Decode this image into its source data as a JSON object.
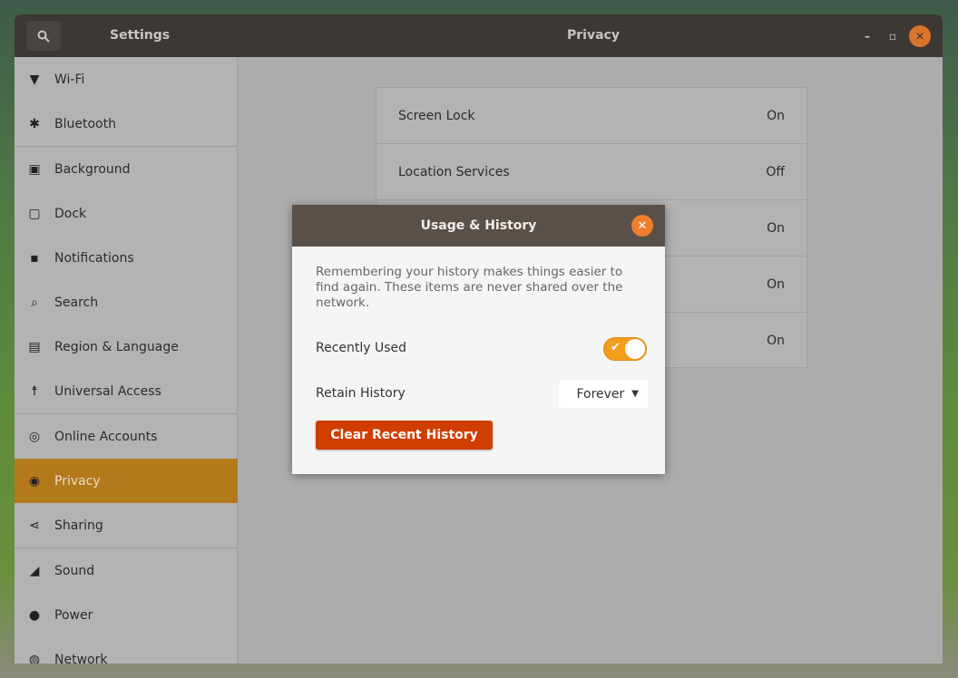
{
  "header": {
    "app_title": "Settings",
    "page_title": "Privacy",
    "search_icon": "search-icon"
  },
  "sidebar": {
    "items": [
      {
        "label": "Wi-Fi",
        "icon": "▼"
      },
      {
        "label": "Bluetooth",
        "icon": "✱"
      },
      {
        "label": "Background",
        "icon": "▣"
      },
      {
        "label": "Dock",
        "icon": "▢"
      },
      {
        "label": "Notifications",
        "icon": "▪"
      },
      {
        "label": "Search",
        "icon": "⌕"
      },
      {
        "label": "Region & Language",
        "icon": "▤"
      },
      {
        "label": "Universal Access",
        "icon": "☨"
      },
      {
        "label": "Online Accounts",
        "icon": "◎"
      },
      {
        "label": "Privacy",
        "icon": "◉"
      },
      {
        "label": "Sharing",
        "icon": "⋖"
      },
      {
        "label": "Sound",
        "icon": "◢"
      },
      {
        "label": "Power",
        "icon": "●"
      },
      {
        "label": "Network",
        "icon": "◍"
      }
    ],
    "selected": "Privacy"
  },
  "privacy_list": [
    {
      "label": "Screen Lock",
      "value": "On"
    },
    {
      "label": "Location Services",
      "value": "Off"
    },
    {
      "label": "",
      "value": "On"
    },
    {
      "label": "",
      "value": "On"
    },
    {
      "label": "",
      "value": "On"
    }
  ],
  "dialog": {
    "title": "Usage & History",
    "description": "Remembering your history makes things easier to find again. These items are never shared over the network.",
    "recently_used_label": "Recently Used",
    "recently_used_on": true,
    "retain_history_label": "Retain History",
    "retain_history_value": "Forever",
    "clear_button": "Clear Recent History"
  }
}
